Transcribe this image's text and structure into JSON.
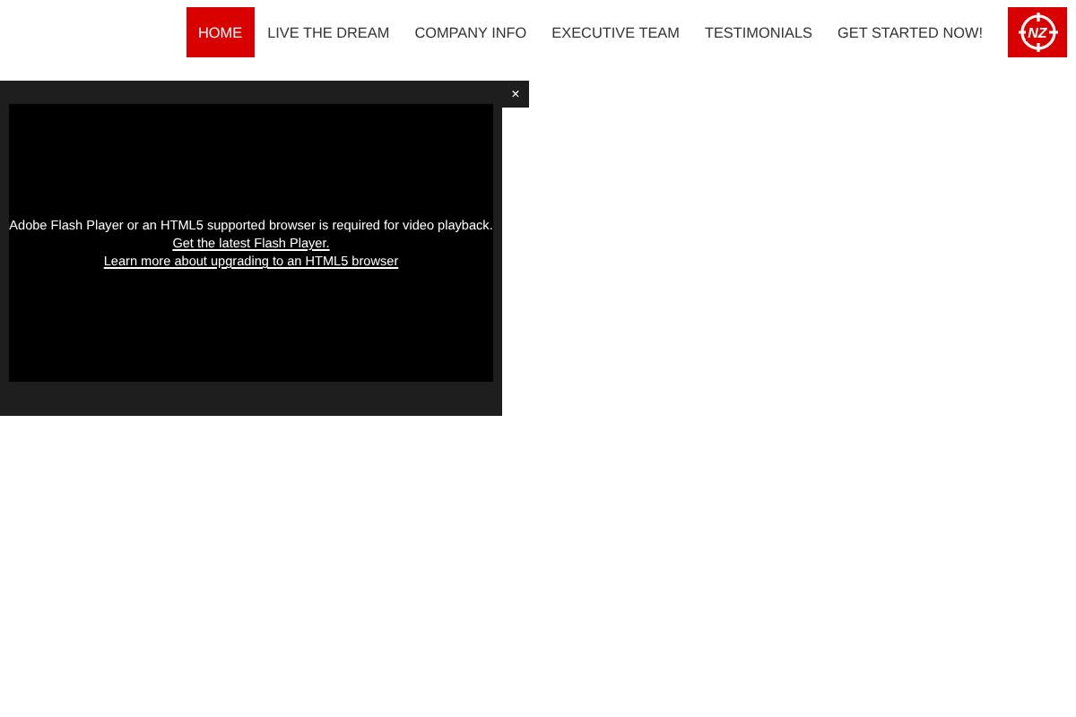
{
  "nav": {
    "items": [
      {
        "label": "HOME",
        "selected": true
      },
      {
        "label": "LIVE THE DREAM",
        "selected": false
      },
      {
        "label": "COMPANY INFO",
        "selected": false
      },
      {
        "label": "EXECUTIVE TEAM",
        "selected": false
      },
      {
        "label": "TESTIMONIALS",
        "selected": false
      },
      {
        "label": "GET STARTED NOW!",
        "selected": false
      }
    ],
    "logo": "NZ"
  },
  "video_modal": {
    "close": "×",
    "message": "Adobe Flash Player or an HTML5 supported browser is required for video playback.",
    "links": [
      "Get the latest Flash Player.",
      "Learn more about upgrading to an HTML5 browser"
    ]
  }
}
